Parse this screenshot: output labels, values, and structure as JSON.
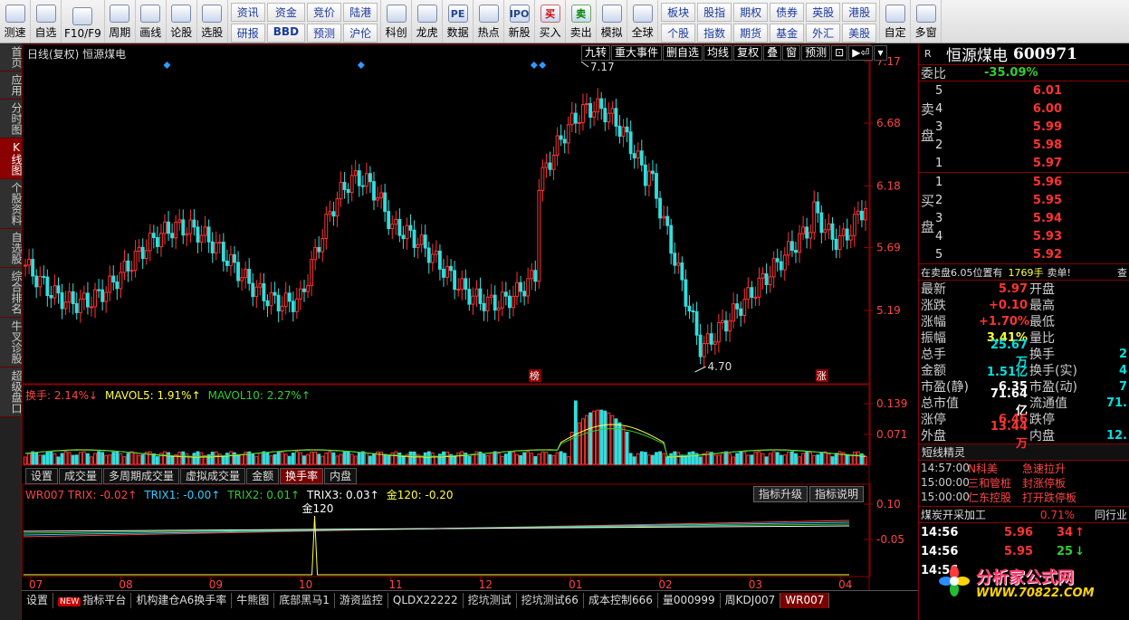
{
  "toolbar": {
    "left_items": [
      {
        "icon": "clock-icon",
        "label": "测速"
      },
      {
        "icon": "star-icon",
        "label": "自选"
      },
      {
        "icon": "card-icon",
        "label": "F10/F9"
      },
      {
        "icon": "cycle-icon",
        "label": "周期"
      },
      {
        "icon": "pencil-icon",
        "label": "画线"
      },
      {
        "icon": "forum-icon",
        "label": "论股"
      },
      {
        "icon": "select-icon",
        "label": "选股"
      }
    ],
    "grid1": [
      "资讯",
      "研报",
      "资金",
      "BBD",
      "竞价",
      "预测",
      "陆港",
      "沪伦"
    ],
    "mid_items": [
      {
        "icon": "chart-icon",
        "label": "科创"
      },
      {
        "icon": "dragon-icon",
        "label": "龙虎"
      },
      {
        "icon": "pe-icon",
        "label": "数据",
        "glyph": "PE"
      },
      {
        "icon": "fire-icon",
        "label": "热点"
      },
      {
        "icon": "ipo-icon",
        "label": "新股",
        "glyph": "IPO"
      },
      {
        "icon": "buy-icon",
        "label": "买入",
        "glyph": "买"
      },
      {
        "icon": "sell-icon",
        "label": "卖出",
        "glyph": "卖"
      },
      {
        "icon": "hammer-icon",
        "label": "模拟"
      },
      {
        "icon": "globe-icon",
        "label": "全球"
      }
    ],
    "grid2": [
      "板块",
      "个股",
      "股指",
      "指数",
      "期权",
      "期货",
      "债券",
      "基金",
      "英股",
      "外汇",
      "港股",
      "美股"
    ],
    "right_items": [
      {
        "icon": "custom-icon",
        "label": "自定"
      },
      {
        "icon": "multi-window-icon",
        "label": "多窗"
      }
    ]
  },
  "left_tabs": [
    "首页",
    "应用",
    "分时图",
    "K线图",
    "个股资料",
    "自选股",
    "综合排名",
    "牛叉诊股",
    "超级盘口"
  ],
  "left_tab_active": 3,
  "chart": {
    "title": "日线(复权)  恒源煤电",
    "buttons": [
      "九转",
      "重大事件",
      "删自选",
      "均线",
      "复权",
      "叠",
      "窗",
      "预测",
      "⊡",
      "▶⏎",
      "▾"
    ],
    "price_axis": [
      "7.17",
      "6.68",
      "6.18",
      "5.69",
      "5.19"
    ],
    "high_label": "7.17",
    "low_label": "4.70",
    "markers": [
      "榜",
      "涨"
    ],
    "vol_legend": [
      {
        "text": "换手: 2.14%↓",
        "color": "#ff4444"
      },
      {
        "text": "MAVOL5: 1.91%↑",
        "color": "#ffff44"
      },
      {
        "text": "MAVOL10: 2.27%↑",
        "color": "#33cc33"
      }
    ],
    "vol_axis": [
      "0.139",
      "0.071"
    ],
    "vol_tabs": [
      "设置",
      "成交量",
      "多周期成交量",
      "虚拟成交量",
      "金额",
      "换手率",
      "内盘"
    ],
    "vol_tab_active": 5,
    "ind_legend": [
      {
        "text": "WR007 TRIX: -0.02↑",
        "color": "#ff4444"
      },
      {
        "text": "TRIX1: -0.00↑",
        "color": "#33ccff"
      },
      {
        "text": "TRIX2: 0.01↑",
        "color": "#33cc33"
      },
      {
        "text": "TRIX3: 0.03↑",
        "color": "#ffffff"
      },
      {
        "text": "金120: -0.20",
        "color": "#ffff44"
      }
    ],
    "ind_buttons": [
      "指标升级",
      "指标说明"
    ],
    "ind_axis": [
      "0.10",
      "-0.05"
    ],
    "ind_marker": "金120",
    "months": [
      "07",
      "08",
      "09",
      "10",
      "11",
      "12",
      "01",
      "02",
      "03",
      "04"
    ]
  },
  "bottom_tabs": [
    "设置",
    "指标平台",
    "机构建仓A6换手率",
    "牛熊图",
    "底部黑马1",
    "游资监控",
    "QLDX22222",
    "挖坑测试",
    "挖坑测试66",
    "成本控制666",
    "量000999",
    "周KDJ007",
    "WR007"
  ],
  "bottom_tab_active": 12,
  "new_badge": "NEW",
  "stock": {
    "r": "R",
    "name": "恒源煤电",
    "code": "600971",
    "weibi_label": "委比",
    "weibi": "-35.09%",
    "sell_side_label": "卖盘",
    "buy_side_label": "买盘",
    "sell": [
      {
        "lv": "5",
        "p": "6.01"
      },
      {
        "lv": "4",
        "p": "6.00"
      },
      {
        "lv": "3",
        "p": "5.99"
      },
      {
        "lv": "2",
        "p": "5.98"
      },
      {
        "lv": "1",
        "p": "5.97"
      }
    ],
    "buy": [
      {
        "lv": "1",
        "p": "5.96"
      },
      {
        "lv": "2",
        "p": "5.95"
      },
      {
        "lv": "3",
        "p": "5.94"
      },
      {
        "lv": "4",
        "p": "5.93"
      },
      {
        "lv": "5",
        "p": "5.92"
      }
    ],
    "info_bar": {
      "text": "在卖盘6.05位置有",
      "qty": "1769手",
      "tag": "卖单!",
      "more": "查"
    },
    "stats_left": [
      {
        "k": "最新",
        "v": "5.97",
        "c": "red"
      },
      {
        "k": "涨跌",
        "v": "+0.10",
        "c": "red"
      },
      {
        "k": "涨幅",
        "v": "+1.70%",
        "c": "red"
      },
      {
        "k": "振幅",
        "v": "3.41%",
        "c": "yel"
      },
      {
        "k": "总手",
        "v": "25.67万",
        "c": "cyan"
      },
      {
        "k": "金额",
        "v": "1.51亿",
        "c": "cyan"
      },
      {
        "k": "市盈(静)",
        "v": "6.35",
        "c": "wht"
      },
      {
        "k": "总市值",
        "v": "71.64亿",
        "c": "wht"
      },
      {
        "k": "涨停",
        "v": "6.46",
        "c": "red"
      },
      {
        "k": "外盘",
        "v": "13.44万",
        "c": "red"
      }
    ],
    "stats_right": [
      {
        "k": "开盘",
        "v": ""
      },
      {
        "k": "最高",
        "v": ""
      },
      {
        "k": "最低",
        "v": ""
      },
      {
        "k": "量比",
        "v": ""
      },
      {
        "k": "换手",
        "v": "2"
      },
      {
        "k": "换手(实)",
        "v": "4"
      },
      {
        "k": "市盈(动)",
        "v": "7"
      },
      {
        "k": "流通值",
        "v": "71."
      },
      {
        "k": "跌停",
        "v": ""
      },
      {
        "k": "内盘",
        "v": "12."
      }
    ],
    "alerts_title": "短线精灵",
    "alerts": [
      {
        "t": "14:57:00",
        "s": "N科美",
        "e": "急速拉升"
      },
      {
        "t": "15:00:00",
        "s": "三和管桩",
        "e": "封涨停板"
      },
      {
        "t": "15:00:00",
        "s": "仁东控股",
        "e": "打开跌停板"
      }
    ],
    "sector": {
      "name": "煤炭开采加工",
      "pct": "0.71%",
      "btn": "同行业"
    },
    "ticks": [
      {
        "t": "14:56",
        "p": "5.96",
        "v": "34",
        "dir": "up"
      },
      {
        "t": "14:56",
        "p": "5.95",
        "v": "25",
        "dir": "down"
      },
      {
        "t": "14:56",
        "p": "",
        "v": "",
        "dir": ""
      }
    ]
  },
  "watermark": {
    "line1": "分析家公式网",
    "line2": "WWW.70822.COM"
  }
}
